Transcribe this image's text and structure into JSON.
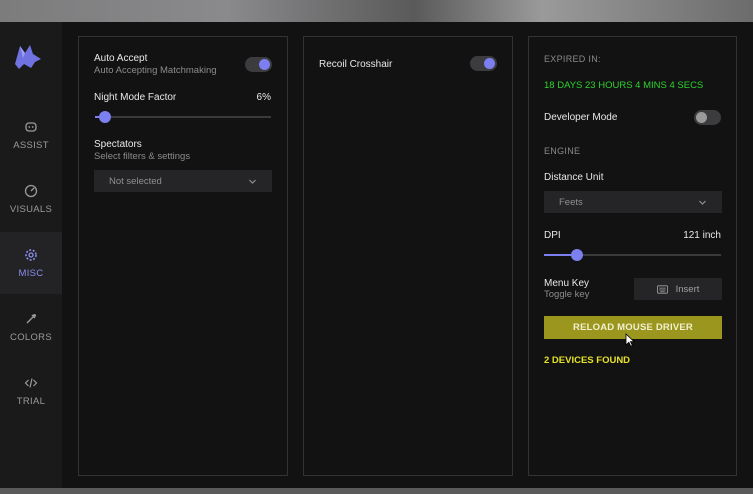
{
  "sidebar": {
    "items": [
      {
        "label": "ASSIST",
        "icon": "robot-face-icon",
        "active": false
      },
      {
        "label": "VISUALS",
        "icon": "gauge-icon",
        "active": false
      },
      {
        "label": "MISC",
        "icon": "gear-icon",
        "active": true
      },
      {
        "label": "COLORS",
        "icon": "eyedropper-icon",
        "active": false
      },
      {
        "label": "TRIAL",
        "icon": "code-icon",
        "active": false
      }
    ]
  },
  "panel1": {
    "auto_accept": {
      "label": "Auto Accept",
      "sub": "Auto Accepting Matchmaking",
      "on": true
    },
    "night_mode": {
      "label": "Night Mode Factor",
      "value": "6%",
      "level": 0.06
    },
    "spectators": {
      "label": "Spectators",
      "sub": "Select filters & settings",
      "select_value": "Not selected"
    }
  },
  "panel2": {
    "recoil": {
      "label": "Recoil Crosshair",
      "on": true
    }
  },
  "panel3": {
    "expired_label": "EXPIRED IN:",
    "expired_value": "18 DAYS 23 HOURS 4 MINS 4 SECS",
    "developer_mode": {
      "label": "Developer Mode",
      "on": false
    },
    "engine_label": "ENGINE",
    "distance_unit": {
      "label": "Distance Unit",
      "select_value": "Feets"
    },
    "dpi": {
      "label": "DPI",
      "value": "121 inch",
      "level": 0.19
    },
    "menu_key": {
      "label": "Menu Key",
      "sub": "Toggle key",
      "key": "Insert"
    },
    "reload_button": "RELOAD MOUSE DRIVER",
    "devices_found": "2 DEVICES FOUND"
  },
  "colors": {
    "accent": "#7c7ff0",
    "expired_green": "#2fd22f",
    "devices_yellow": "#e6e22a",
    "reload_bg": "#9a961e"
  }
}
